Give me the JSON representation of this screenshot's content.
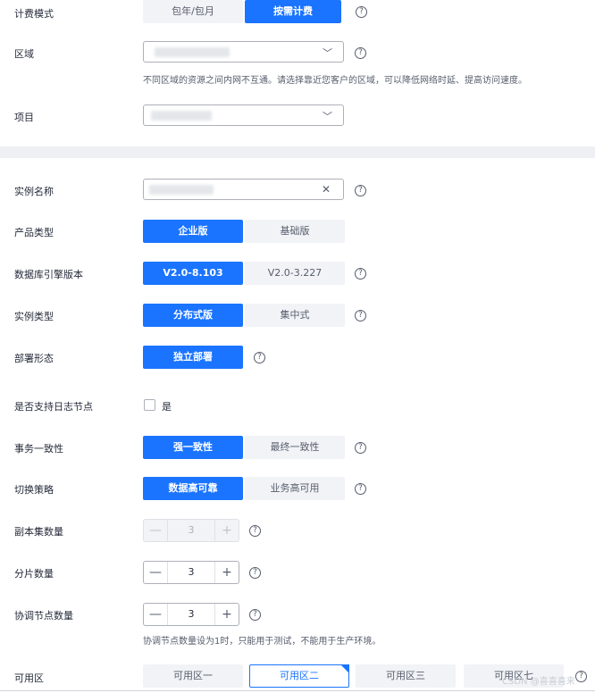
{
  "billing": {
    "label": "计费模式",
    "options": [
      "包年/包月",
      "按需计费"
    ],
    "selected": "按需计费"
  },
  "region": {
    "label": "区域",
    "hint": "不同区域的资源之间内网不互通。请选择靠近您客户的区域，可以降低网络时延、提高访问速度。"
  },
  "project": {
    "label": "项目"
  },
  "instance_name": {
    "label": "实例名称",
    "clear": "✕"
  },
  "product_type": {
    "label": "产品类型",
    "options": [
      "企业版",
      "基础版"
    ],
    "selected": "企业版"
  },
  "engine_version": {
    "label": "数据库引擎版本",
    "options": [
      "V2.0-8.103",
      "V2.0-3.227"
    ],
    "selected": "V2.0-8.103"
  },
  "instance_type": {
    "label": "实例类型",
    "options": [
      "分布式版",
      "集中式"
    ],
    "selected": "分布式版"
  },
  "deploy_form": {
    "label": "部署形态",
    "options": [
      "独立部署"
    ],
    "selected": "独立部署"
  },
  "log_node": {
    "label": "是否支持日志节点",
    "checkbox_label": "是",
    "checked": false
  },
  "transaction_consistency": {
    "label": "事务一致性",
    "options": [
      "强一致性",
      "最终一致性"
    ],
    "selected": "强一致性"
  },
  "switch_strategy": {
    "label": "切换策略",
    "options": [
      "数据高可靠",
      "业务高可用"
    ],
    "selected": "数据高可靠"
  },
  "replica_count": {
    "label": "副本集数量",
    "value": "3",
    "minus": "—",
    "plus": "+"
  },
  "shard_count": {
    "label": "分片数量",
    "value": "3",
    "minus": "—",
    "plus": "+"
  },
  "coordinator_count": {
    "label": "协调节点数量",
    "value": "3",
    "minus": "—",
    "plus": "+",
    "hint": "协调节点数量设为1时，只能用于测试，不能用于生产环境。"
  },
  "availability_zone": {
    "label": "可用区",
    "options": [
      "可用区一",
      "可用区二",
      "可用区三",
      "可用区七"
    ],
    "selected": "可用区二"
  },
  "icons": {
    "help": "?",
    "chevron": "﹀",
    "check": "✓"
  },
  "watermark": "CSDN @喜喜喜来",
  "colors": {
    "accent": "#1a74ff",
    "muted_bg": "#f1f3f6",
    "text": "#252b3a"
  }
}
